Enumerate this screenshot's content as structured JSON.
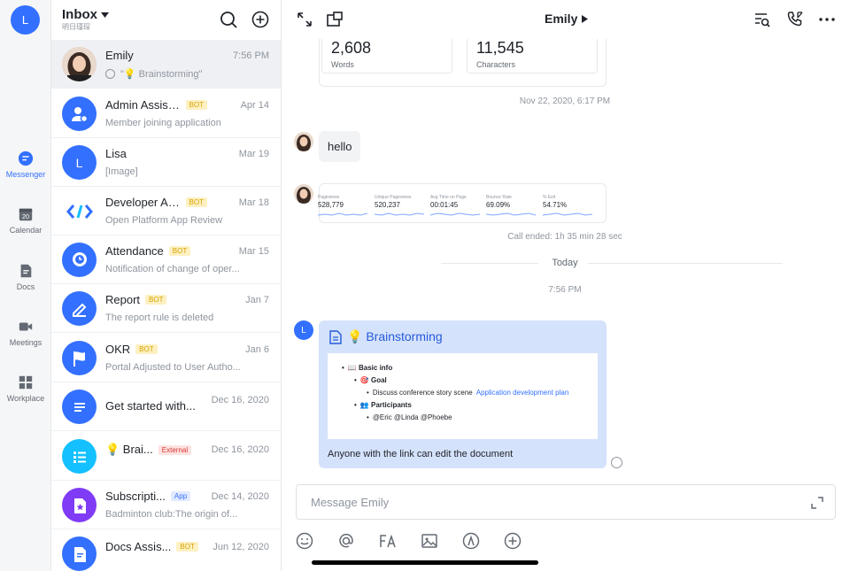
{
  "user": {
    "initial": "L"
  },
  "rail": {
    "items": [
      {
        "label": "Messenger",
        "active": true
      },
      {
        "label": "Calendar",
        "date": "20"
      },
      {
        "label": "Docs"
      },
      {
        "label": "Meetings"
      },
      {
        "label": "Workplace"
      }
    ]
  },
  "inbox": {
    "title": "Inbox",
    "subtitle": "明日瑾琛"
  },
  "chats": [
    {
      "name": "Emily",
      "time": "7:56 PM",
      "preview": "\"💡 Brainstorming\"",
      "avatar": "photo",
      "selected": true
    },
    {
      "name": "Admin Assistant",
      "badge": "BOT",
      "time": "Apr 14",
      "preview": "Member joining application",
      "avatar_color": "#3370ff"
    },
    {
      "name": "Lisa",
      "time": "Mar 19",
      "preview": "[Image]",
      "avatar_color": "#3370ff",
      "initial": "L"
    },
    {
      "name": "Developer Assis...",
      "badge": "BOT",
      "time": "Mar 18",
      "preview": "Open Platform App Review",
      "avatar_color": "#ffffff"
    },
    {
      "name": "Attendance",
      "badge": "BOT",
      "time": "Mar 15",
      "preview": "Notification of change of oper...",
      "avatar_color": "#3370ff"
    },
    {
      "name": "Report",
      "badge": "BOT",
      "time": "Jan 7",
      "preview": "The report rule is deleted",
      "avatar_color": "#3370ff"
    },
    {
      "name": "OKR",
      "badge": "BOT",
      "time": "Jan 6",
      "preview": "Portal Adjusted to User Autho...",
      "avatar_color": "#3370ff"
    },
    {
      "name": "Get started with...",
      "time": "Dec 16, 2020",
      "preview": "",
      "avatar_color": "#3370ff"
    },
    {
      "name": "💡 Brai...",
      "badge": "External",
      "time": "Dec 16, 2020",
      "preview": "",
      "avatar_color": "#14c0ff"
    },
    {
      "name": "Subscripti...",
      "badge": "App",
      "time": "Dec 14, 2020",
      "preview": "Badminton club:The origin of...",
      "avatar_color": "#7f3bf5"
    },
    {
      "name": "Docs Assis...",
      "badge": "BOT",
      "time": "Jun 12, 2020",
      "preview": "",
      "avatar_color": "#3370ff"
    }
  ],
  "conversation": {
    "title": "Emily",
    "stats": [
      {
        "value": "2,608",
        "label": "Words"
      },
      {
        "value": "11,545",
        "label": "Characters"
      }
    ],
    "ts1": "Nov 22, 2020, 6:17 PM",
    "hello": "hello",
    "dashboard": [
      {
        "label": "Pageviews",
        "value": "528,779"
      },
      {
        "label": "Unique Pageviews",
        "value": "520,237"
      },
      {
        "label": "Avg Time on Page",
        "value": "00:01:45"
      },
      {
        "label": "Bounce Rate",
        "value": "69.09%"
      },
      {
        "label": "% Exit",
        "value": "54.71%"
      }
    ],
    "call_ended": "Call ended: 1h 35 min 28 sec",
    "today": "Today",
    "ts2": "7:56 PM",
    "sender_initial": "L",
    "doc": {
      "title": "💡 Brainstorming",
      "basic_info": "📖 Basic info",
      "goal": "🎯 Goal",
      "goal_text": "Discuss conference story scene",
      "goal_link": "Application development plan",
      "participants": "👥 Participants",
      "participants_text": "@Eric @Linda @Phoebe",
      "footer": "Anyone with the link can edit the document"
    },
    "input_placeholder": "Message Emily"
  },
  "colors": {
    "accent": "#3370ff",
    "bot_badge": "#d7a300",
    "doc_card": "#d5e2fb"
  }
}
